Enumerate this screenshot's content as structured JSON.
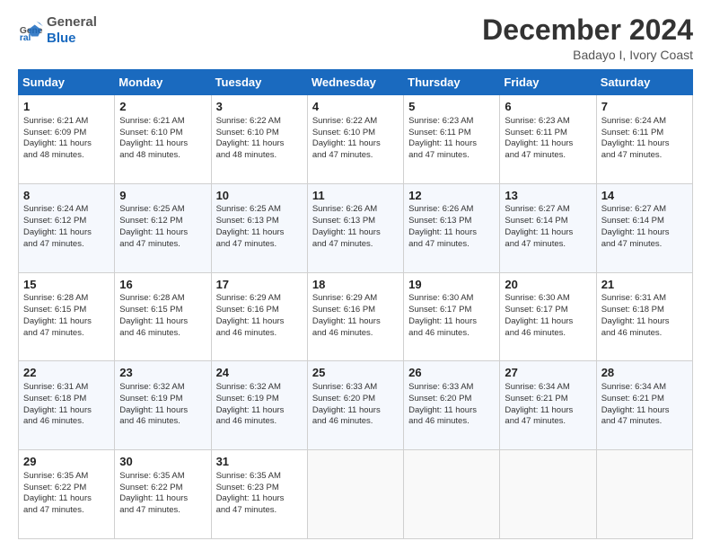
{
  "header": {
    "logo_line1": "General",
    "logo_line2": "Blue",
    "month_title": "December 2024",
    "location": "Badayo I, Ivory Coast"
  },
  "weekdays": [
    "Sunday",
    "Monday",
    "Tuesday",
    "Wednesday",
    "Thursday",
    "Friday",
    "Saturday"
  ],
  "weeks": [
    [
      {
        "day": "1",
        "lines": [
          "Sunrise: 6:21 AM",
          "Sunset: 6:09 PM",
          "Daylight: 11 hours",
          "and 48 minutes."
        ]
      },
      {
        "day": "2",
        "lines": [
          "Sunrise: 6:21 AM",
          "Sunset: 6:10 PM",
          "Daylight: 11 hours",
          "and 48 minutes."
        ]
      },
      {
        "day": "3",
        "lines": [
          "Sunrise: 6:22 AM",
          "Sunset: 6:10 PM",
          "Daylight: 11 hours",
          "and 48 minutes."
        ]
      },
      {
        "day": "4",
        "lines": [
          "Sunrise: 6:22 AM",
          "Sunset: 6:10 PM",
          "Daylight: 11 hours",
          "and 47 minutes."
        ]
      },
      {
        "day": "5",
        "lines": [
          "Sunrise: 6:23 AM",
          "Sunset: 6:11 PM",
          "Daylight: 11 hours",
          "and 47 minutes."
        ]
      },
      {
        "day": "6",
        "lines": [
          "Sunrise: 6:23 AM",
          "Sunset: 6:11 PM",
          "Daylight: 11 hours",
          "and 47 minutes."
        ]
      },
      {
        "day": "7",
        "lines": [
          "Sunrise: 6:24 AM",
          "Sunset: 6:11 PM",
          "Daylight: 11 hours",
          "and 47 minutes."
        ]
      }
    ],
    [
      {
        "day": "8",
        "lines": [
          "Sunrise: 6:24 AM",
          "Sunset: 6:12 PM",
          "Daylight: 11 hours",
          "and 47 minutes."
        ]
      },
      {
        "day": "9",
        "lines": [
          "Sunrise: 6:25 AM",
          "Sunset: 6:12 PM",
          "Daylight: 11 hours",
          "and 47 minutes."
        ]
      },
      {
        "day": "10",
        "lines": [
          "Sunrise: 6:25 AM",
          "Sunset: 6:13 PM",
          "Daylight: 11 hours",
          "and 47 minutes."
        ]
      },
      {
        "day": "11",
        "lines": [
          "Sunrise: 6:26 AM",
          "Sunset: 6:13 PM",
          "Daylight: 11 hours",
          "and 47 minutes."
        ]
      },
      {
        "day": "12",
        "lines": [
          "Sunrise: 6:26 AM",
          "Sunset: 6:13 PM",
          "Daylight: 11 hours",
          "and 47 minutes."
        ]
      },
      {
        "day": "13",
        "lines": [
          "Sunrise: 6:27 AM",
          "Sunset: 6:14 PM",
          "Daylight: 11 hours",
          "and 47 minutes."
        ]
      },
      {
        "day": "14",
        "lines": [
          "Sunrise: 6:27 AM",
          "Sunset: 6:14 PM",
          "Daylight: 11 hours",
          "and 47 minutes."
        ]
      }
    ],
    [
      {
        "day": "15",
        "lines": [
          "Sunrise: 6:28 AM",
          "Sunset: 6:15 PM",
          "Daylight: 11 hours",
          "and 47 minutes."
        ]
      },
      {
        "day": "16",
        "lines": [
          "Sunrise: 6:28 AM",
          "Sunset: 6:15 PM",
          "Daylight: 11 hours",
          "and 46 minutes."
        ]
      },
      {
        "day": "17",
        "lines": [
          "Sunrise: 6:29 AM",
          "Sunset: 6:16 PM",
          "Daylight: 11 hours",
          "and 46 minutes."
        ]
      },
      {
        "day": "18",
        "lines": [
          "Sunrise: 6:29 AM",
          "Sunset: 6:16 PM",
          "Daylight: 11 hours",
          "and 46 minutes."
        ]
      },
      {
        "day": "19",
        "lines": [
          "Sunrise: 6:30 AM",
          "Sunset: 6:17 PM",
          "Daylight: 11 hours",
          "and 46 minutes."
        ]
      },
      {
        "day": "20",
        "lines": [
          "Sunrise: 6:30 AM",
          "Sunset: 6:17 PM",
          "Daylight: 11 hours",
          "and 46 minutes."
        ]
      },
      {
        "day": "21",
        "lines": [
          "Sunrise: 6:31 AM",
          "Sunset: 6:18 PM",
          "Daylight: 11 hours",
          "and 46 minutes."
        ]
      }
    ],
    [
      {
        "day": "22",
        "lines": [
          "Sunrise: 6:31 AM",
          "Sunset: 6:18 PM",
          "Daylight: 11 hours",
          "and 46 minutes."
        ]
      },
      {
        "day": "23",
        "lines": [
          "Sunrise: 6:32 AM",
          "Sunset: 6:19 PM",
          "Daylight: 11 hours",
          "and 46 minutes."
        ]
      },
      {
        "day": "24",
        "lines": [
          "Sunrise: 6:32 AM",
          "Sunset: 6:19 PM",
          "Daylight: 11 hours",
          "and 46 minutes."
        ]
      },
      {
        "day": "25",
        "lines": [
          "Sunrise: 6:33 AM",
          "Sunset: 6:20 PM",
          "Daylight: 11 hours",
          "and 46 minutes."
        ]
      },
      {
        "day": "26",
        "lines": [
          "Sunrise: 6:33 AM",
          "Sunset: 6:20 PM",
          "Daylight: 11 hours",
          "and 46 minutes."
        ]
      },
      {
        "day": "27",
        "lines": [
          "Sunrise: 6:34 AM",
          "Sunset: 6:21 PM",
          "Daylight: 11 hours",
          "and 47 minutes."
        ]
      },
      {
        "day": "28",
        "lines": [
          "Sunrise: 6:34 AM",
          "Sunset: 6:21 PM",
          "Daylight: 11 hours",
          "and 47 minutes."
        ]
      }
    ],
    [
      {
        "day": "29",
        "lines": [
          "Sunrise: 6:35 AM",
          "Sunset: 6:22 PM",
          "Daylight: 11 hours",
          "and 47 minutes."
        ]
      },
      {
        "day": "30",
        "lines": [
          "Sunrise: 6:35 AM",
          "Sunset: 6:22 PM",
          "Daylight: 11 hours",
          "and 47 minutes."
        ]
      },
      {
        "day": "31",
        "lines": [
          "Sunrise: 6:35 AM",
          "Sunset: 6:23 PM",
          "Daylight: 11 hours",
          "and 47 minutes."
        ]
      },
      null,
      null,
      null,
      null
    ]
  ]
}
